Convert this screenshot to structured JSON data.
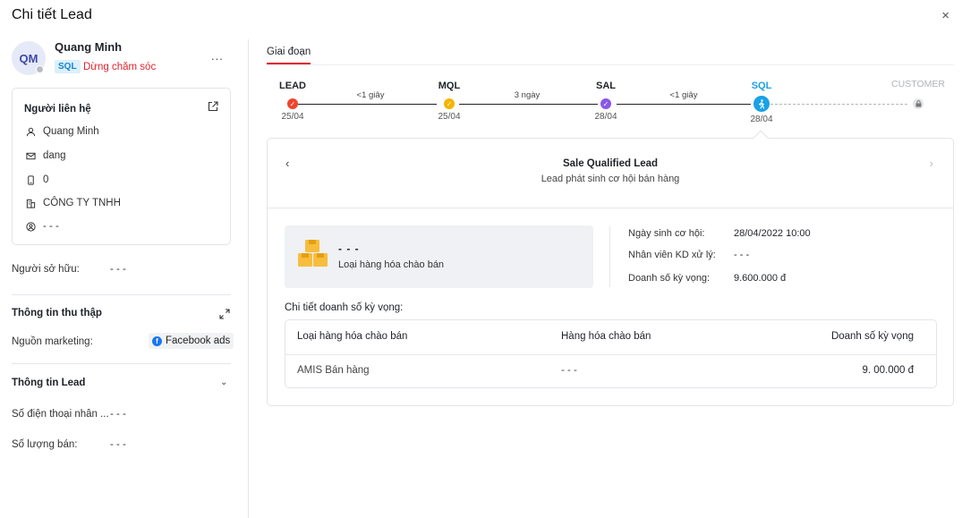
{
  "header": {
    "title": "Chi tiết Lead",
    "close_icon": "×"
  },
  "lead": {
    "avatar_initials": "QM",
    "name": "Quang Minh",
    "stage_tag": "SQL",
    "status": "Dừng chăm sóc",
    "more": "..."
  },
  "contact": {
    "title": "Người liên hệ",
    "name": "Quang Minh",
    "email": "dang",
    "phone": "0",
    "company": "CÔNG TY TNHH",
    "role": "- - -"
  },
  "owner": {
    "label": "Người sở hữu:",
    "value": "- - -"
  },
  "collect": {
    "title": "Thông tin thu thập",
    "marketing_label": "Nguồn marketing:",
    "marketing_value": "Facebook ads"
  },
  "lead_info": {
    "title": "Thông tin Lead",
    "phone_label": "Số điện thoại nhân ...",
    "phone_value": "- - -",
    "qty_label": "Số lượng bán:",
    "qty_value": "- - -"
  },
  "tabs": {
    "stage": "Giai đoạn"
  },
  "stages": [
    {
      "name": "LEAD",
      "date": "25/04",
      "color": "#f0442c"
    },
    {
      "name": "MQL",
      "date": "25/04",
      "color": "#f5b400"
    },
    {
      "name": "SAL",
      "date": "28/04",
      "color": "#8a57e8"
    },
    {
      "name": "SQL",
      "date": "28/04",
      "color": "#1aa1e6"
    },
    {
      "name": "CUSTOMER",
      "date": "",
      "color": "#9a9da3"
    }
  ],
  "durations": [
    "<1 giây",
    "3 ngày",
    "<1 giây"
  ],
  "detail": {
    "title": "Sale Qualified Lead",
    "subtitle": "Lead phát sinh cơ hội bán hàng",
    "product_name": "- - -",
    "product_category": "Loại hàng hóa chào bán",
    "opp_date_label": "Ngày sinh cơ hội:",
    "opp_date_value": "28/04/2022 10:00",
    "staff_label": "Nhân viên KD xử lý:",
    "staff_value": "- - -",
    "revenue_label": "Doanh số kỳ vọng:",
    "revenue_value": "9.600.000 đ"
  },
  "sales": {
    "title": "Chi tiết doanh số kỳ vọng:",
    "columns": [
      "Loại hàng hóa chào bán",
      "Hàng hóa chào bán",
      "Doanh số kỳ vọng"
    ],
    "rows": [
      [
        "AMIS Bán hàng",
        "- - -",
        "9.  00.000 đ"
      ]
    ]
  }
}
